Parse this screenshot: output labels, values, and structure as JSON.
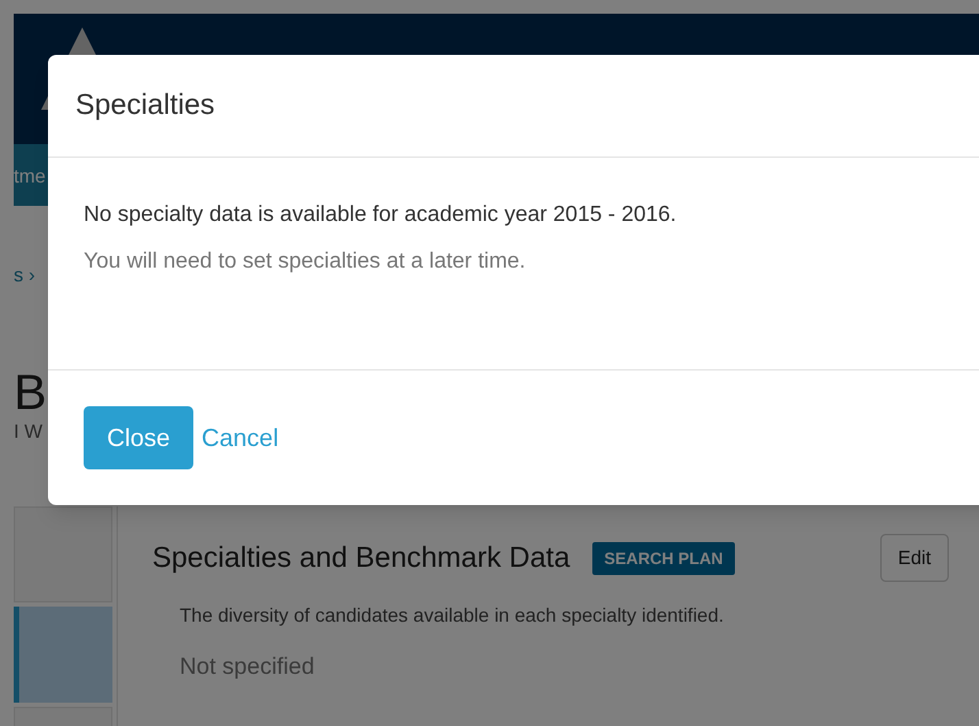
{
  "background": {
    "nav_fragment": "tme",
    "breadcrumb_fragment": "s ›",
    "heading_fragment": "B",
    "subtitle_fragment": "I W",
    "sidebar": [
      {
        "selected": false
      },
      {
        "selected": true
      },
      {
        "selected": false
      }
    ],
    "section": {
      "title": "Specialties and Benchmark Data",
      "badge": "SEARCH PLAN",
      "edit_button": "Edit",
      "description": "The diversity of candidates available in each specialty identified.",
      "value": "Not specified"
    }
  },
  "modal": {
    "title": "Specialties",
    "message": "No specialty data is available for academic year 2015 - 2016.",
    "note": "You will need to set specialties at a later time.",
    "buttons": [
      {
        "label": "Close",
        "kind": "primary"
      },
      {
        "label": "Cancel",
        "kind": "link"
      }
    ]
  }
}
